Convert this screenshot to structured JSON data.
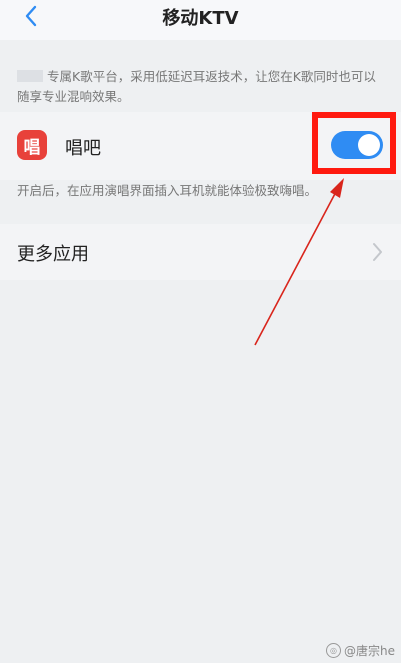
{
  "header": {
    "title": "移动KTV"
  },
  "description": {
    "text": "专属K歌平台，采用低延迟耳返技术，让您在K歌同时也可以随享专业混响效果。"
  },
  "app_row": {
    "icon_glyph": "唱",
    "name": "唱吧",
    "toggle_on": true
  },
  "hint": {
    "text": "开启后，在应用演唱界面插入耳机就能体验极致嗨唱。"
  },
  "more": {
    "label": "更多应用"
  },
  "watermark": {
    "text": "@唐宗he"
  },
  "colors": {
    "toggle_on": "#2f8cf3",
    "highlight": "#ff1a10",
    "app_icon": "#e8413a"
  }
}
